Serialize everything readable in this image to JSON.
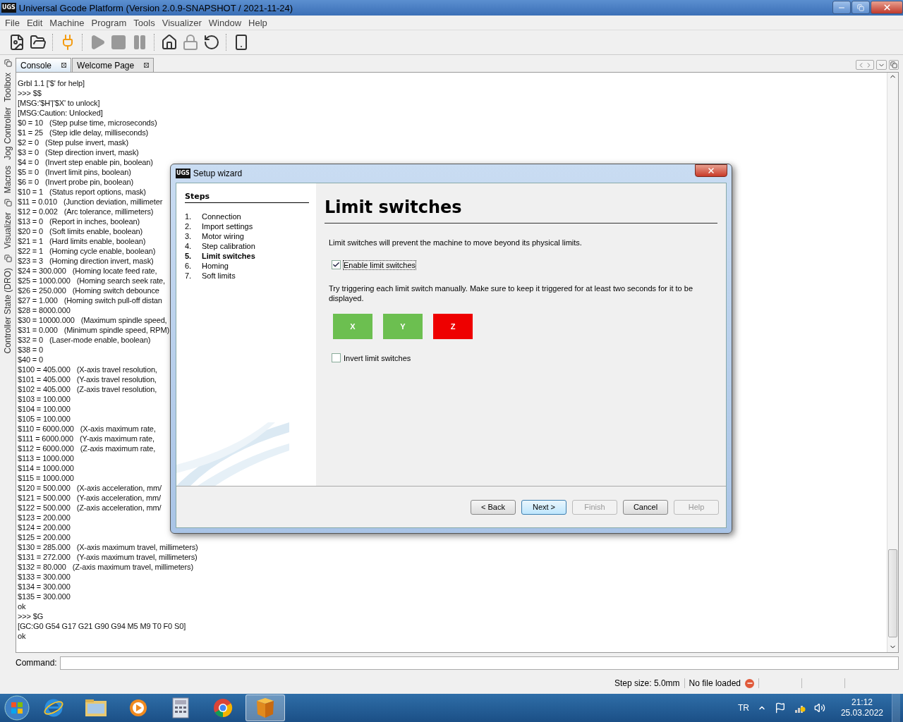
{
  "window": {
    "logo": "UGS",
    "title": "Universal Gcode Platform (Version 2.0.9-SNAPSHOT / 2021-11-24)"
  },
  "menu": [
    "File",
    "Edit",
    "Machine",
    "Program",
    "Tools",
    "Visualizer",
    "Window",
    "Help"
  ],
  "side_panels": [
    {
      "label": "Toolbox"
    },
    {
      "label": "Jog Controller"
    },
    {
      "label": "Macros"
    },
    {
      "label": "Visualizer"
    },
    {
      "label": "Controller State (DRO)"
    }
  ],
  "tabs": [
    {
      "label": "Console",
      "selected": true
    },
    {
      "label": "Welcome Page",
      "selected": false
    }
  ],
  "console": {
    "lines": [
      {
        "text": "Grbl 1.1 ['$' for help]"
      },
      {
        "text": ">>> $$"
      },
      {
        "text": "[MSG:'$H'|'$X' to unlock]"
      },
      {
        "text": "[MSG:Caution: Unlocked]"
      },
      {
        "setting": "$0 = 10",
        "comment": "(Step pulse time, microseconds)"
      },
      {
        "setting": "$1 = 25",
        "comment": "(Step idle delay, milliseconds)"
      },
      {
        "setting": "$2 = 0",
        "comment": "(Step pulse invert, mask)"
      },
      {
        "setting": "$3 = 0",
        "comment": "(Step direction invert, mask)"
      },
      {
        "setting": "$4 = 0",
        "comment": "(Invert step enable pin, boolean)"
      },
      {
        "setting": "$5 = 0",
        "comment": "(Invert limit pins, boolean)"
      },
      {
        "setting": "$6 = 0",
        "comment": "(Invert probe pin, boolean)"
      },
      {
        "setting": "$10 = 1",
        "comment": "(Status report options, mask)"
      },
      {
        "setting": "$11 = 0.010",
        "comment": "(Junction deviation, millimeter"
      },
      {
        "setting": "$12 = 0.002",
        "comment": "(Arc tolerance, millimeters)"
      },
      {
        "setting": "$13 = 0",
        "comment": "(Report in inches, boolean)"
      },
      {
        "setting": "$20 = 0",
        "comment": "(Soft limits enable, boolean)"
      },
      {
        "setting": "$21 = 1",
        "comment": "(Hard limits enable, boolean)"
      },
      {
        "setting": "$22 = 1",
        "comment": "(Homing cycle enable, boolean)"
      },
      {
        "setting": "$23 = 3",
        "comment": "(Homing direction invert, mask)"
      },
      {
        "setting": "$24 = 300.000",
        "comment": "(Homing locate feed rate,"
      },
      {
        "setting": "$25 = 1000.000",
        "comment": "(Homing search seek rate,"
      },
      {
        "setting": "$26 = 250.000",
        "comment": "(Homing switch debounce"
      },
      {
        "setting": "$27 = 1.000",
        "comment": "(Homing switch pull-off distan"
      },
      {
        "setting": "$28 = 8000.000"
      },
      {
        "setting": "$30 = 10000.000",
        "comment": "(Maximum spindle speed,"
      },
      {
        "setting": "$31 = 0.000",
        "comment": "(Minimum spindle speed, RPM)"
      },
      {
        "setting": "$32 = 0",
        "comment": "(Laser-mode enable, boolean)"
      },
      {
        "setting": "$38 = 0"
      },
      {
        "setting": "$40 = 0"
      },
      {
        "setting": "$100 = 405.000",
        "comment": "(X-axis travel resolution,"
      },
      {
        "setting": "$101 = 405.000",
        "comment": "(Y-axis travel resolution,"
      },
      {
        "setting": "$102 = 405.000",
        "comment": "(Z-axis travel resolution,"
      },
      {
        "setting": "$103 = 100.000"
      },
      {
        "setting": "$104 = 100.000"
      },
      {
        "setting": "$105 = 100.000"
      },
      {
        "setting": "$110 = 6000.000",
        "comment": "(X-axis maximum rate,"
      },
      {
        "setting": "$111 = 6000.000",
        "comment": "(Y-axis maximum rate,"
      },
      {
        "setting": "$112 = 6000.000",
        "comment": "(Z-axis maximum rate,"
      },
      {
        "setting": "$113 = 1000.000"
      },
      {
        "setting": "$114 = 1000.000"
      },
      {
        "setting": "$115 = 1000.000"
      },
      {
        "setting": "$120 = 500.000",
        "comment": "(X-axis acceleration, mm/"
      },
      {
        "setting": "$121 = 500.000",
        "comment": "(Y-axis acceleration, mm/"
      },
      {
        "setting": "$122 = 500.000",
        "comment": "(Z-axis acceleration, mm/"
      },
      {
        "setting": "$123 = 200.000"
      },
      {
        "setting": "$124 = 200.000"
      },
      {
        "setting": "$125 = 200.000"
      },
      {
        "setting": "$130 = 285.000",
        "comment": "(X-axis maximum travel, millimeters)"
      },
      {
        "setting": "$131 = 272.000",
        "comment": "(Y-axis maximum travel, millimeters)"
      },
      {
        "setting": "$132 = 80.000",
        "comment": "(Z-axis maximum travel, millimeters)"
      },
      {
        "setting": "$133 = 300.000"
      },
      {
        "setting": "$134 = 300.000"
      },
      {
        "setting": "$135 = 300.000"
      },
      {
        "text": "ok"
      },
      {
        "text": ">>> $G"
      },
      {
        "text": "[GC:G0 G54 G17 G21 G90 G94 M5 M9 T0 F0 S0]"
      },
      {
        "text": "ok"
      }
    ]
  },
  "command": {
    "label": "Command:"
  },
  "status_bar": {
    "step_size": "Step size: 5.0mm",
    "file_status": "No file loaded"
  },
  "dialog": {
    "logo": "UGS",
    "title": "Setup wizard",
    "steps_heading": "Steps",
    "steps": [
      {
        "number": "1.",
        "label": "Connection",
        "selected": false
      },
      {
        "number": "2.",
        "label": "Import settings",
        "selected": false
      },
      {
        "number": "3.",
        "label": "Motor wiring",
        "selected": false
      },
      {
        "number": "4.",
        "label": "Step calibration",
        "selected": false
      },
      {
        "number": "5.",
        "label": "Limit switches",
        "selected": true
      },
      {
        "number": "6.",
        "label": "Homing",
        "selected": false
      },
      {
        "number": "7.",
        "label": "Soft limits",
        "selected": false
      }
    ],
    "heading": "Limit switches",
    "description": "Limit switches will prevent the machine to move beyond its physical limits.",
    "enable_checkbox": {
      "label": "Enable limit switches",
      "checked": true
    },
    "instructions": "Try triggering each limit switch manually. Make sure to keep it triggered for at least two seconds for it to be displayed.",
    "switches": [
      {
        "label": "X",
        "triggered": false
      },
      {
        "label": "Y",
        "triggered": false
      },
      {
        "label": "Z",
        "triggered": true
      }
    ],
    "invert_checkbox": {
      "label": "Invert limit switches",
      "checked": false
    },
    "buttons": [
      {
        "label": "< Back",
        "disabled": false,
        "selected": false
      },
      {
        "label": "Next >",
        "disabled": false,
        "selected": true
      },
      {
        "label": "Finish",
        "disabled": true,
        "selected": false
      },
      {
        "label": "Cancel",
        "disabled": false,
        "selected": false
      },
      {
        "label": "Help",
        "disabled": true,
        "selected": false
      }
    ]
  },
  "taskbar": {
    "apps": [
      {
        "kind": "ie",
        "active": false
      },
      {
        "kind": "explorer",
        "active": false
      },
      {
        "kind": "media",
        "active": false
      },
      {
        "kind": "calculator",
        "active": false
      },
      {
        "kind": "chrome",
        "active": false
      },
      {
        "kind": "ugs",
        "active": true
      }
    ],
    "language": "TR",
    "time": "21:12",
    "date": "25.03.2022"
  }
}
